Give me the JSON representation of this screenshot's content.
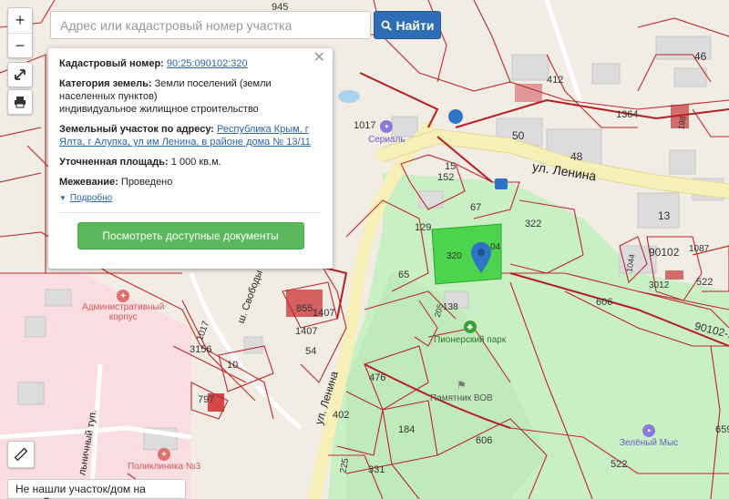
{
  "search": {
    "placeholder": "Адрес или кадастровый номер участка",
    "button_label": "Найти"
  },
  "controls": {
    "zoom_in": "+",
    "zoom_out": "−"
  },
  "popup": {
    "cadastral_label": "Кадастровый номер:",
    "cadastral_value": "90:25:090102:320",
    "category_label": "Категория земель:",
    "category_value_line1": "Земли поселений (земли",
    "category_value_line2": "населенных пунктов)",
    "category_use": "индивидуальное жилищное строительство",
    "address_label": "Земельный участок по адресу:",
    "address_value": "Республика Крым, г Ялта, г Алупка, ул им Ленина, в районе дома № 13/11",
    "area_label": "Уточненная площадь:",
    "area_value": "1 000 кв.м.",
    "survey_label": "Межевание:",
    "survey_value": "Проведено",
    "details_link": "Подробно",
    "docs_button": "Посмотреть доступные документы"
  },
  "bottom_link": "Не нашли участок/дом на карте?",
  "map": {
    "streets": {
      "lenina": "ул. Ленина",
      "lenina_2": "ул. Ленина",
      "svobody": "ш. Свободы",
      "lnichny": "льничный туп."
    },
    "pois": {
      "serial": "Сериаль",
      "admin_line1": "Административный",
      "admin_line2": "корпус",
      "park": "Пионерский парк",
      "monument": "Памятник ВОВ",
      "clinic": "Поликлиника №3",
      "zeleny_mys": "Зелёный Мыс"
    },
    "parcel_labels": [
      "945",
      "46",
      "412",
      "1364",
      "198",
      "1017",
      "50",
      "48",
      "15",
      "152",
      "67",
      "322",
      "13",
      "129",
      "320",
      "04",
      "90102",
      "1087",
      "1044",
      "65",
      "3012",
      "522",
      "606",
      "90102-1",
      "205",
      "138",
      "1017",
      "855",
      "1407",
      "1407",
      "54",
      "3156",
      "10",
      "476",
      "797",
      "402",
      "184",
      "606",
      "659",
      "522",
      "225",
      "331"
    ]
  },
  "colors": {
    "parcel_selected": "#4cd44c",
    "park": "#c7f0c3",
    "road": "#f8f0b0",
    "boundary": "#c0282b",
    "search_button": "#2e6eb5",
    "docs_button": "#5cb85c",
    "link": "#2a64b0"
  }
}
